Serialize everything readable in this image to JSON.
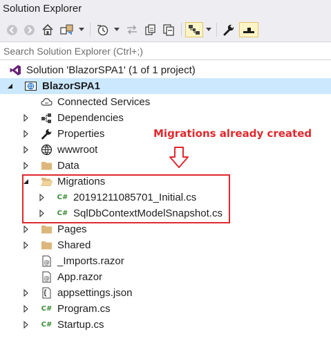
{
  "window": {
    "title": "Solution Explorer"
  },
  "toolbar": {
    "buttons": [
      {
        "name": "back-icon"
      },
      {
        "name": "forward-icon"
      },
      {
        "name": "home-icon"
      },
      {
        "name": "switch-views-icon"
      },
      {
        "name": "dropdown-icon"
      },
      {
        "name": "pending-changes-filter-icon"
      },
      {
        "name": "dropdown-icon"
      },
      {
        "name": "sync-with-active-document-icon"
      },
      {
        "name": "refresh-icon"
      },
      {
        "name": "collapse-all-icon"
      },
      {
        "name": "show-all-files-icon"
      },
      {
        "name": "properties-wrench-icon"
      },
      {
        "name": "preview-selected-items-icon"
      }
    ]
  },
  "search": {
    "placeholder": "Search Solution Explorer (Ctrl+;)",
    "value": ""
  },
  "tree": {
    "solution": {
      "label": "Solution 'BlazorSPA1' (1 of 1 project)"
    },
    "project": {
      "label": "BlazorSPA1"
    },
    "items": [
      {
        "label": "Connected Services",
        "icon": "cloud-icon"
      },
      {
        "label": "Dependencies",
        "icon": "dependencies-icon"
      },
      {
        "label": "Properties",
        "icon": "wrench-icon"
      },
      {
        "label": "wwwroot",
        "icon": "globe-icon"
      },
      {
        "label": "Data",
        "icon": "folder-icon"
      },
      {
        "label": "Migrations",
        "icon": "folder-open-icon"
      },
      {
        "label": "20191211085701_Initial.cs",
        "icon": "csharp-file-icon"
      },
      {
        "label": "SqlDbContextModelSnapshot.cs",
        "icon": "csharp-file-icon"
      },
      {
        "label": "Pages",
        "icon": "folder-icon"
      },
      {
        "label": "Shared",
        "icon": "folder-icon"
      },
      {
        "label": "_Imports.razor",
        "icon": "razor-file-icon"
      },
      {
        "label": "App.razor",
        "icon": "razor-file-icon"
      },
      {
        "label": "appsettings.json",
        "icon": "json-file-icon"
      },
      {
        "label": "Program.cs",
        "icon": "csharp-file-icon"
      },
      {
        "label": "Startup.cs",
        "icon": "csharp-file-icon"
      }
    ]
  },
  "annotation": {
    "text": "Migrations already created",
    "color": "#e0282d"
  },
  "colors": {
    "selection": "#cce8ff",
    "folder": "#dcb67a",
    "csharp": "#388a34",
    "toolbar_bg": "#eeeef2"
  }
}
